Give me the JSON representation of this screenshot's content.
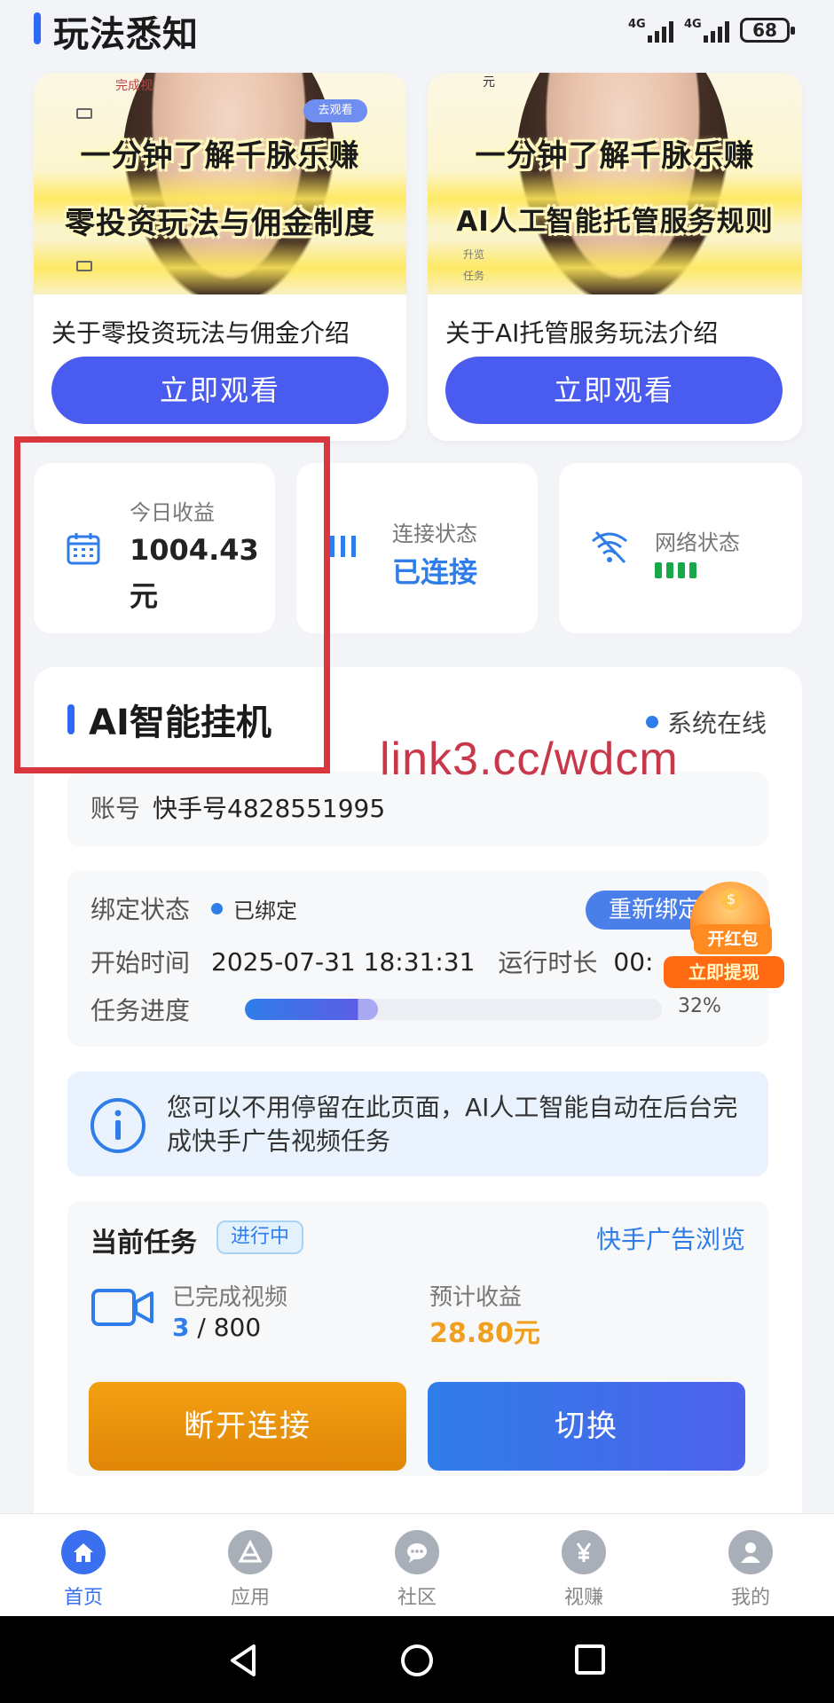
{
  "header": {
    "title": "玩法悉知"
  },
  "status_bar": {
    "signal1": "4G",
    "signal2": "4G",
    "battery": "68"
  },
  "videos": [
    {
      "caption_line1": "一分钟了解千脉乐赚",
      "caption_line2": "零投资玩法与佣金制度",
      "thumb_small_top": "完成视",
      "thumb_small_mid": "去观看",
      "description": "关于零投资玩法与佣金介绍",
      "button": "立即观看"
    },
    {
      "caption_line1": "一分钟了解千脉乐赚",
      "caption_line2": "AI人工智能托管服务规则",
      "thumb_small_top": "元",
      "thumb_small_mid": "升览",
      "thumb_small_bot": "任务",
      "description": "关于AI托管服务玩法介绍",
      "button": "立即观看"
    }
  ],
  "stats": {
    "today_income_label": "今日收益",
    "today_income_value": "1004.43元",
    "connection_label": "连接状态",
    "connection_value": "已连接",
    "network_label": "网络状态",
    "network_level": 1.0
  },
  "hangup": {
    "title": "AI智能挂机",
    "system_status": "系统在线",
    "account_label": "账号",
    "account_value": "快手号4828551995",
    "bind_label": "绑定状态",
    "bind_value": "已绑定",
    "rebind_button": "重新绑定",
    "start_label": "开始时间",
    "start_value": "2025-07-31 18:31:31",
    "runtime_label": "运行时长",
    "runtime_value": "00:",
    "progress_label": "任务进度",
    "progress_percent": 32,
    "progress_text": "32%",
    "notice": "您可以不用停留在此页面，AI人工智能自动在后台完成快手广告视频任务",
    "current_task_label": "当前任务",
    "task_state": "进行中",
    "task_source": "快手广告浏览",
    "done_label": "已完成视频",
    "done_count": "3",
    "done_total": "/ 800",
    "estimate_label": "预计收益",
    "estimate_value": "28.80元",
    "disconnect_button": "断开连接",
    "switch_button": "切换"
  },
  "red_packet": {
    "line1": "开红包",
    "line2": "立即提现"
  },
  "watermark": "link3.cc/wdcm",
  "bottom_nav": [
    {
      "label": "首页",
      "icon": "home-icon",
      "active": true
    },
    {
      "label": "应用",
      "icon": "apps-icon",
      "active": false
    },
    {
      "label": "社区",
      "icon": "chat-icon",
      "active": false
    },
    {
      "label": "视赚",
      "icon": "yuan-icon",
      "active": false
    },
    {
      "label": "我的",
      "icon": "user-icon",
      "active": false
    }
  ],
  "colors": {
    "primary": "#4a5cf0",
    "accent_blue": "#2f7de8",
    "success": "#18a84a",
    "warning": "#f0a020",
    "orange_button": "#e08608",
    "highlight_box": "#d9363e"
  }
}
